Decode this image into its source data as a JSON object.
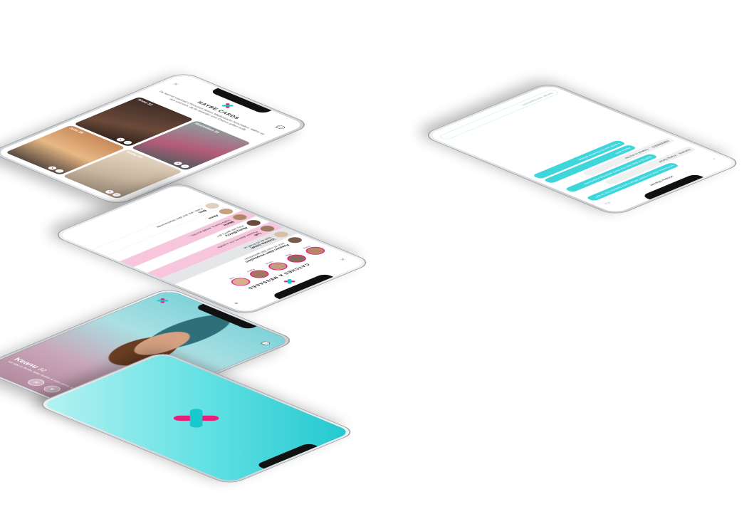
{
  "cards_screen": {
    "title": "HAYBE CARDS",
    "description": "Du kannst maximal 4 Personen deines Maybestacks freischalten. Wähle sie aus und sieh, ob ihr einander eine Chance geben wollt.",
    "cards": [
      {
        "name": "Anna 32"
      },
      {
        "name": "Maximilian 33"
      },
      {
        "name": "Julia 28"
      },
      {
        "name": "Kathy 26"
      }
    ]
  },
  "chats_screen": {
    "title": "CATCHES & MESSAGES",
    "stories": [
      {
        "label": "Anna"
      },
      {
        "label": "Ella"
      },
      {
        "label": "Laura"
      },
      {
        "label": "Kathy"
      },
      {
        "label": "Lea"
      }
    ],
    "rows": [
      {
        "name": "Passion Abet verstreden!",
        "preview": "Jetzt ist eure Zeit gekommen",
        "tone": "white"
      },
      {
        "name": "Victoria (new)",
        "preview": "Sieh dir ihr Profil an",
        "tone": "grey"
      },
      {
        "name": "Luli",
        "preview": "Passion Abet Hi, I'm a profile",
        "tone": "pink"
      },
      {
        "name": "Ahmy-Blerry",
        "preview": "Hey, wie geht's dir?",
        "tone": "white"
      },
      {
        "name": "Maria",
        "preview": "Hallo Keanu, would you like...",
        "tone": "pink"
      },
      {
        "name": "Anna",
        "preview": "",
        "tone": "white"
      },
      {
        "name": "Ben",
        "preview": "Hallo, wie war dein Wochenende",
        "tone": "white"
      }
    ]
  },
  "conversation_screen": {
    "contact": "Keanu Marcel",
    "messages": [
      {
        "dir": "out",
        "text": "Hi Keanu, nice to match! What's your favorite trip so far?"
      },
      {
        "dir": "in",
        "text": "Hehehe... Hang loose!"
      },
      {
        "dir": "out",
        "text": "Surfing in Bali was the most amazing experience"
      },
      {
        "dir": "in",
        "text": "YEEEEEES ... Hawaii is my fav"
      },
      {
        "dir": "out",
        "text": "Aloha lol!!!"
      },
      {
        "dir": "out",
        "text": "I send you my favorite photos"
      }
    ],
    "composer_placeholder": "Sende eine Nachricht..."
  },
  "profile_screen": {
    "name": "Keanu",
    "age": "32",
    "bio": "Ich lebe in Berlin, liebe Surfen & reise gerne. Ich mag Hunde und Pizza."
  }
}
